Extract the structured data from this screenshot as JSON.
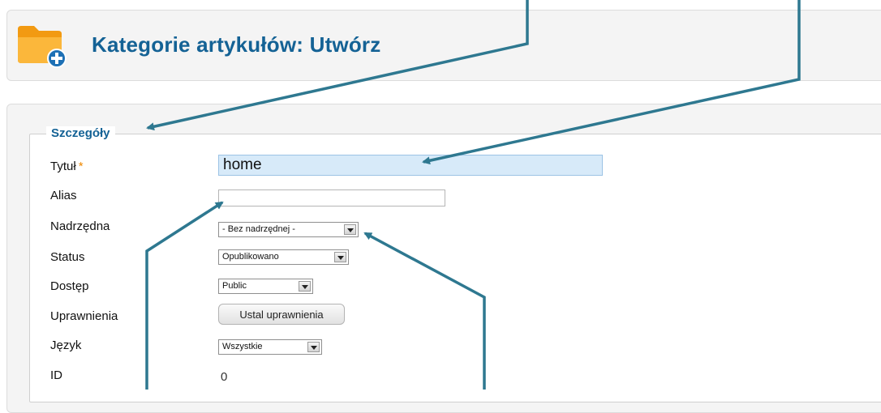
{
  "header": {
    "title": "Kategorie artykułów: Utwórz",
    "icon": "folder-add-icon"
  },
  "form": {
    "legend": "Szczegóły",
    "fields": {
      "title": {
        "label": "Tytuł",
        "required_mark": "*",
        "value": "home"
      },
      "alias": {
        "label": "Alias",
        "value": ""
      },
      "parent": {
        "label": "Nadrzędna",
        "selected": "- Bez nadrzędnej -"
      },
      "status": {
        "label": "Status",
        "selected": "Opublikowano"
      },
      "access": {
        "label": "Dostęp",
        "selected": "Public"
      },
      "permissions": {
        "label": "Uprawnienia",
        "button_label": "Ustal uprawnienia"
      },
      "language": {
        "label": "Język",
        "selected": "Wszystkie"
      },
      "id": {
        "label": "ID",
        "value": "0"
      }
    }
  },
  "colors": {
    "title_blue": "#146295",
    "annotation_arrow": "#2e7890",
    "input_highlight": "#d7eaf9",
    "folder_orange": "#f7a21b",
    "required_mark": "#ee8800"
  }
}
